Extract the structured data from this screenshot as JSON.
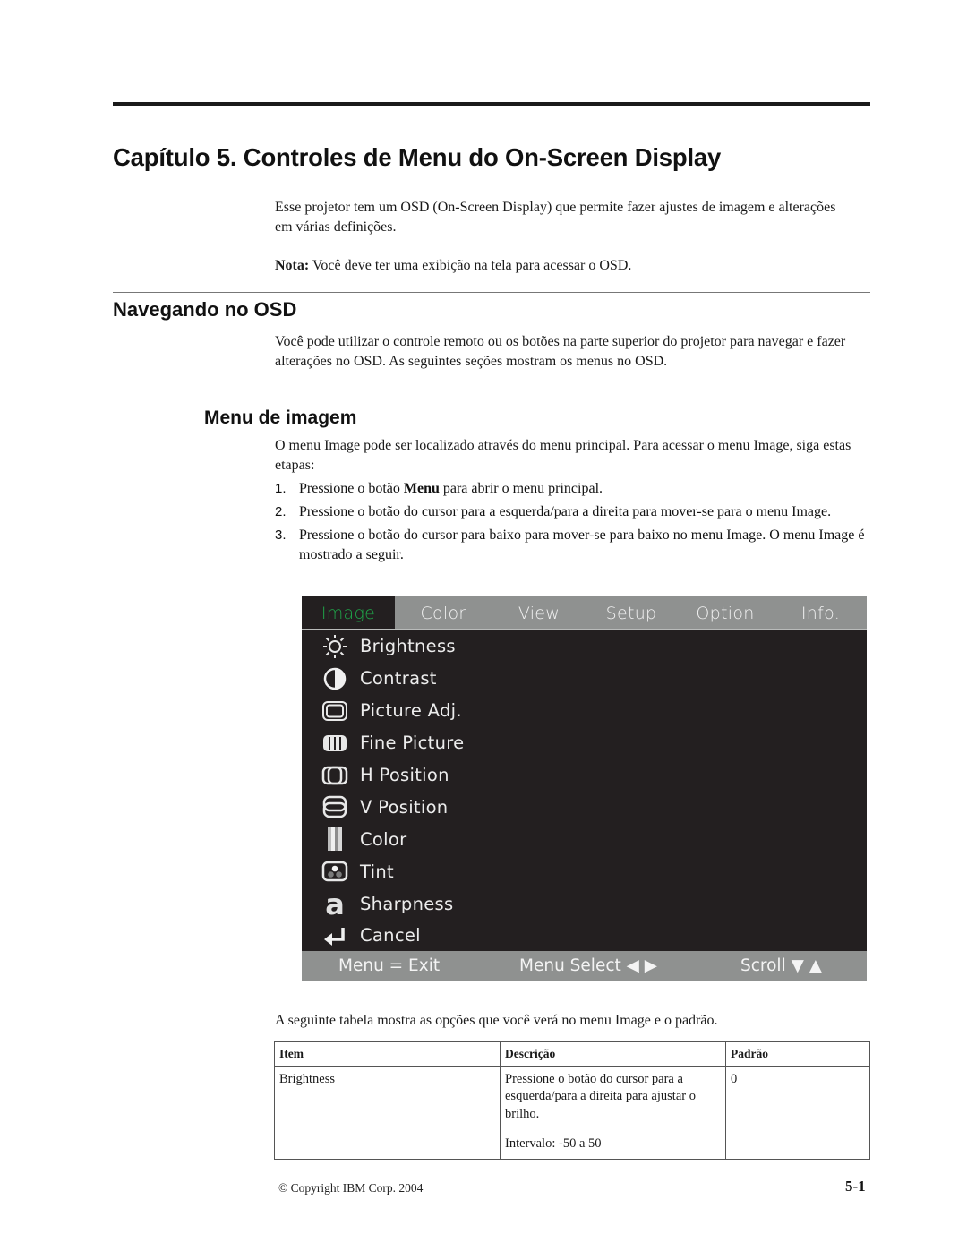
{
  "chapter": {
    "title": "Capítulo 5. Controles de Menu do On-Screen Display",
    "intro": "Esse projetor tem um OSD (On-Screen Display) que permite fazer ajustes de imagem e alterações em várias definições.",
    "note_label": "Nota:",
    "note_text": " Você deve ter uma exibição na tela para acessar o OSD."
  },
  "section": {
    "title": "Navegando no OSD",
    "text": "Você pode utilizar o controle remoto ou os botões na parte superior do projetor para navegar e fazer alterações no OSD. As seguintes seções mostram os menus no OSD."
  },
  "subsection": {
    "title": "Menu de imagem",
    "text": "O menu Image pode ser localizado através do menu principal. Para acessar o menu Image, siga estas etapas:",
    "steps": [
      {
        "num": "1.",
        "before": "Pressione o botão ",
        "bold": "Menu",
        "after": " para abrir o menu principal."
      },
      {
        "num": "2.",
        "before": "Pressione o botão do cursor para a esquerda/para a direita para mover-se para o menu Image.",
        "bold": "",
        "after": ""
      },
      {
        "num": "3.",
        "before": "Pressione o botão do cursor para baixo para mover-se para baixo no menu Image. O menu Image é mostrado a seguir.",
        "bold": "",
        "after": ""
      }
    ]
  },
  "osd": {
    "colors": {
      "background": "#231f20",
      "bar": "#8f9190",
      "active_tab_text": "#1fa84a",
      "text": "#ececec"
    },
    "tabs": [
      {
        "label": "Image",
        "active": true
      },
      {
        "label": "Color",
        "active": false
      },
      {
        "label": "View",
        "active": false
      },
      {
        "label": "Setup",
        "active": false
      },
      {
        "label": "Option",
        "active": false
      },
      {
        "label": "Info.",
        "active": false
      }
    ],
    "items": [
      {
        "label": "Brightness",
        "icon": "sun-icon"
      },
      {
        "label": "Contrast",
        "icon": "contrast-icon"
      },
      {
        "label": "Picture Adj.",
        "icon": "screen-icon"
      },
      {
        "label": "Fine Picture",
        "icon": "bars-icon"
      },
      {
        "label": "H Position",
        "icon": "h-position-icon"
      },
      {
        "label": "V Position",
        "icon": "v-position-icon"
      },
      {
        "label": "Color",
        "icon": "color-bars-icon"
      },
      {
        "label": "Tint",
        "icon": "tint-icon"
      },
      {
        "label": "Sharpness",
        "icon": "sharpness-icon"
      },
      {
        "label": "Cancel",
        "icon": "return-icon"
      }
    ],
    "footer": {
      "exit": "Menu = Exit",
      "select": "Menu Select ◀ ▶",
      "scroll": "Scroll ▼ ▲"
    }
  },
  "table_intro": "A seguinte tabela mostra as opções que você verá no menu Image e o padrão.",
  "table": {
    "headers": [
      "Item",
      "Descrição",
      "Padrão"
    ],
    "rows": [
      {
        "item": "Brightness",
        "description": "Pressione o botão do cursor para a esquerda/para a direita para ajustar o brilho.",
        "range": "Intervalo: -50 a 50",
        "default": "0"
      }
    ]
  },
  "footer": {
    "copyright": "© Copyright IBM Corp. 2004",
    "page": "5-1"
  }
}
